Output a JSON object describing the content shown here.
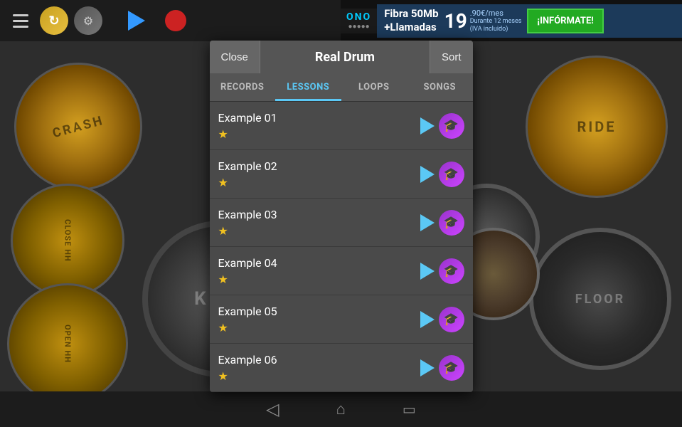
{
  "topBar": {
    "hamburger": "☰",
    "play_label": "play",
    "stop_label": "stop"
  },
  "ad": {
    "brand": "ONO",
    "line1": "Fibra 50Mb",
    "line2": "+Llamadas",
    "price": "19",
    "price_decimal": ".90€/mes",
    "price_note": "Durante 12 meses\n(IVA incluido)",
    "cta": "¡INFÓRMATE!"
  },
  "modal": {
    "close_label": "Close",
    "title": "Real Drum",
    "sort_label": "Sort",
    "tabs": [
      {
        "id": "records",
        "label": "RECORDS",
        "active": false
      },
      {
        "id": "lessons",
        "label": "LESSONS",
        "active": true
      },
      {
        "id": "loops",
        "label": "LOOPS",
        "active": false
      },
      {
        "id": "songs",
        "label": "SONGS",
        "active": false
      }
    ],
    "items": [
      {
        "name": "Example 01",
        "star": "★"
      },
      {
        "name": "Example 02",
        "star": "★"
      },
      {
        "name": "Example 03",
        "star": "★"
      },
      {
        "name": "Example 04",
        "star": "★"
      },
      {
        "name": "Example 05",
        "star": "★"
      },
      {
        "name": "Example 06",
        "star": "★"
      }
    ]
  },
  "drums": {
    "crash": "CRASH",
    "ride": "RIDE",
    "close_hh": "CLOSE HH",
    "open_hh": "OPEN HH",
    "floor": "FLOOR",
    "kick": "KICK"
  },
  "bottomNav": {
    "back": "back",
    "home": "home",
    "recent": "recent"
  }
}
